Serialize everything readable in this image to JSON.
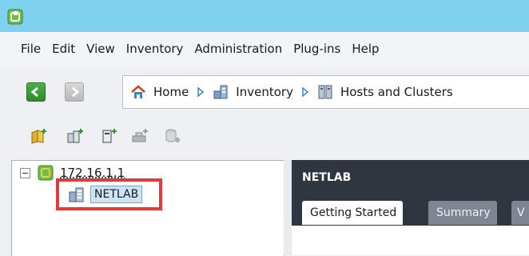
{
  "menu": [
    "File",
    "Edit",
    "View",
    "Inventory",
    "Administration",
    "Plug-ins",
    "Help"
  ],
  "breadcrumb": {
    "home": "Home",
    "inventory": "Inventory",
    "hosts_clusters": "Hosts and Clusters"
  },
  "tree": {
    "host": "172.16.1.1",
    "datacenter": "NETLAB"
  },
  "panel": {
    "title": "NETLAB",
    "tabs": [
      "Getting Started",
      "Summary",
      "V"
    ]
  },
  "colors": {
    "titlebar": "#7ed2f0",
    "panel_header": "#2f3640",
    "highlight": "#e03a3a",
    "selection": "#cde4f7"
  }
}
